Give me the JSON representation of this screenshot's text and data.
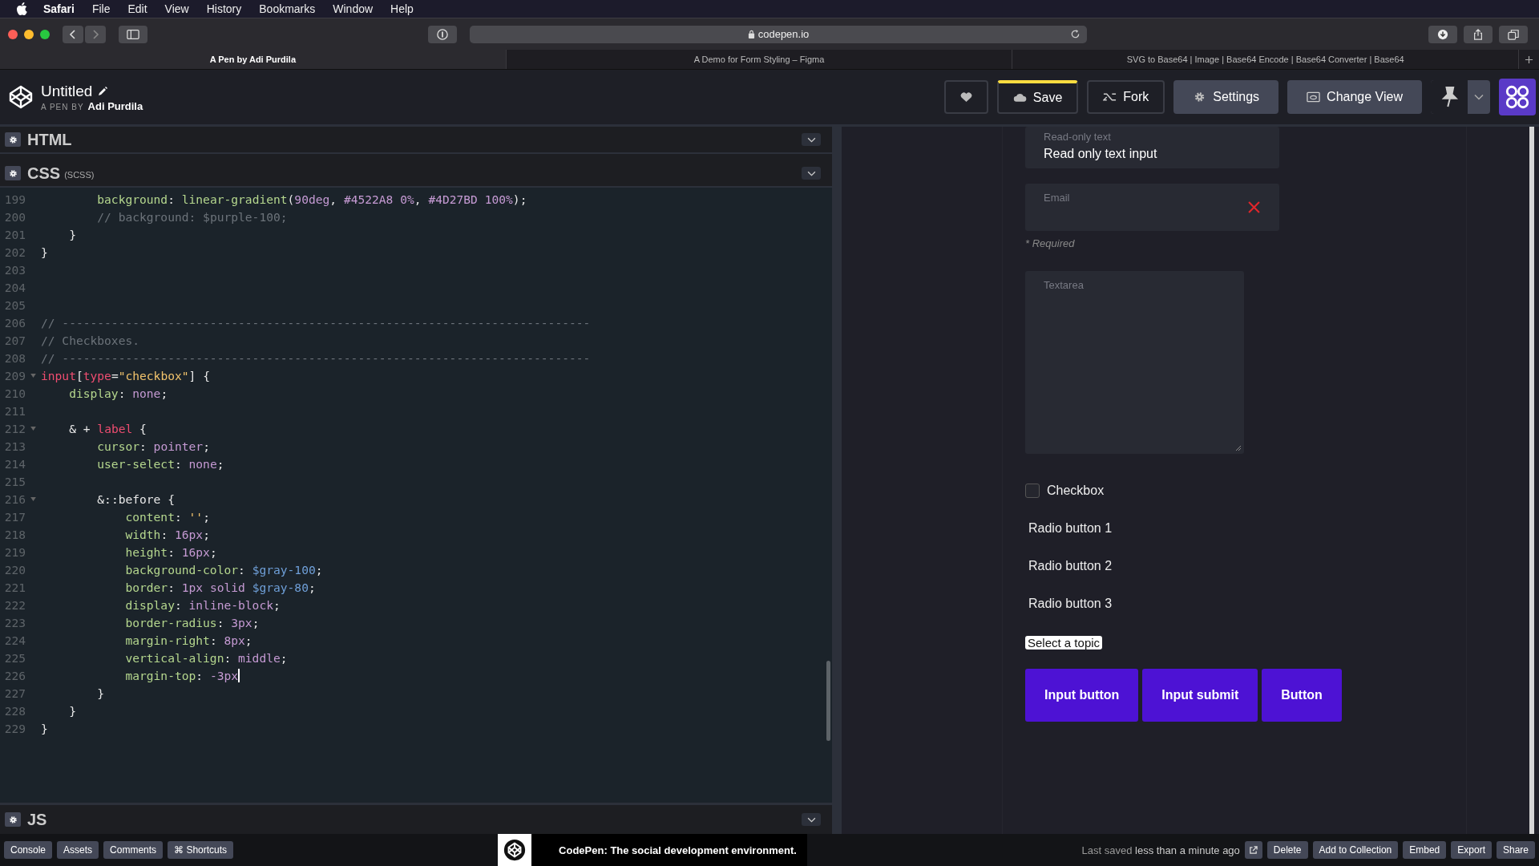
{
  "menu_bar": {
    "app": "Safari",
    "items": [
      "File",
      "Edit",
      "View",
      "History",
      "Bookmarks",
      "Window",
      "Help"
    ]
  },
  "browser": {
    "address": "codepen.io",
    "tabs": [
      {
        "label": "A Pen by Adi Purdila",
        "selected": true
      },
      {
        "label": "A Demo for Form Styling – Figma",
        "selected": false
      },
      {
        "label": "SVG to Base64 | Image | Base64 Encode | Base64 Converter | Base64",
        "selected": false
      }
    ]
  },
  "pen_header": {
    "title": "Untitled",
    "byline": "A PEN BY",
    "author": "Adi Purdila",
    "buttons": [
      {
        "kind": "heart"
      },
      {
        "kind": "save",
        "label": "Save"
      },
      {
        "kind": "fork",
        "label": "Fork"
      },
      {
        "kind": "settings",
        "label": "Settings"
      },
      {
        "kind": "view",
        "label": "Change View"
      }
    ]
  },
  "editors": [
    {
      "name": "HTML"
    },
    {
      "name": "CSS",
      "note": "(SCSS)"
    }
  ],
  "code_lines": [
    {
      "number": "199",
      "fold": false,
      "text": "        background: linear-gradient(90deg, #4522A8 0%, #4D27BD 100%);"
    },
    {
      "number": "200",
      "fold": false,
      "text": "        // background: $purple-100;"
    },
    {
      "number": "201",
      "fold": false,
      "text": "    }"
    },
    {
      "number": "202",
      "fold": false,
      "text": "}"
    },
    {
      "number": "203",
      "fold": false
    },
    {
      "number": "204",
      "fold": false
    },
    {
      "number": "205",
      "fold": false
    },
    {
      "number": "206",
      "fold": false,
      "text": "// ---------------------------------------------------------------------------"
    },
    {
      "number": "207",
      "fold": false,
      "text": "// Checkboxes."
    },
    {
      "number": "208",
      "fold": false,
      "text": "// ---------------------------------------------------------------------------"
    },
    {
      "number": "209",
      "fold": true,
      "text": "input[type=\"checkbox\"] {"
    },
    {
      "number": "210",
      "fold": false,
      "text": "    display: none;"
    },
    {
      "number": "211",
      "fold": false
    },
    {
      "number": "212",
      "fold": true,
      "text": "    & + label {"
    },
    {
      "number": "213",
      "fold": false,
      "text": "        cursor: pointer;"
    },
    {
      "number": "214",
      "fold": false,
      "text": "        user-select: none;"
    },
    {
      "number": "215",
      "fold": false
    },
    {
      "number": "216",
      "fold": true,
      "text": "        &::before {"
    },
    {
      "number": "217",
      "fold": false,
      "text": "            content: '';"
    },
    {
      "number": "218",
      "fold": false,
      "text": "            width: 16px;"
    },
    {
      "number": "219",
      "fold": false,
      "text": "            height: 16px;"
    },
    {
      "number": "220",
      "fold": false,
      "text": "            background-color: $gray-100;"
    },
    {
      "number": "221",
      "fold": false,
      "text": "            border: 1px solid $gray-80;"
    },
    {
      "number": "222",
      "fold": false,
      "text": "            display: inline-block;"
    },
    {
      "number": "223",
      "fold": false,
      "text": "            border-radius: 3px;"
    },
    {
      "number": "224",
      "fold": false,
      "text": "            margin-right: 8px;"
    },
    {
      "number": "225",
      "fold": false,
      "text": "            vertical-align: middle;"
    },
    {
      "number": "226",
      "fold": false,
      "text": "            margin-top: -3px",
      "cursor": true
    },
    {
      "number": "227",
      "fold": false,
      "text": "        }"
    },
    {
      "number": "228",
      "fold": false,
      "text": "    }"
    },
    {
      "number": "229",
      "fold": false,
      "text": "}"
    }
  ],
  "js_editor": {
    "name": "JS"
  },
  "preview": {
    "readonly_field": {
      "label": "Read-only text",
      "value": "Read only text input"
    },
    "email_field": {
      "placeholder": "Email",
      "error": true
    },
    "required_note": "* Required",
    "textarea": {
      "placeholder": "Textarea"
    },
    "checkbox": {
      "label": "Checkbox",
      "checked": false
    },
    "radios": [
      "Radio button 1",
      "Radio button 2",
      "Radio button 3"
    ],
    "select": {
      "value": "Select a topic"
    },
    "buttons": [
      "Input button",
      "Input submit",
      "Button"
    ]
  },
  "footer": {
    "left_buttons": [
      "Console",
      "Assets",
      "Comments",
      "⌘ Shortcuts"
    ],
    "promo": "CodePen: The social development environment.",
    "saved_prefix": "Last saved",
    "saved_time": "less than a minute ago",
    "right_buttons": [
      "Delete",
      "Add to Collection",
      "Embed",
      "Export",
      "Share"
    ]
  }
}
